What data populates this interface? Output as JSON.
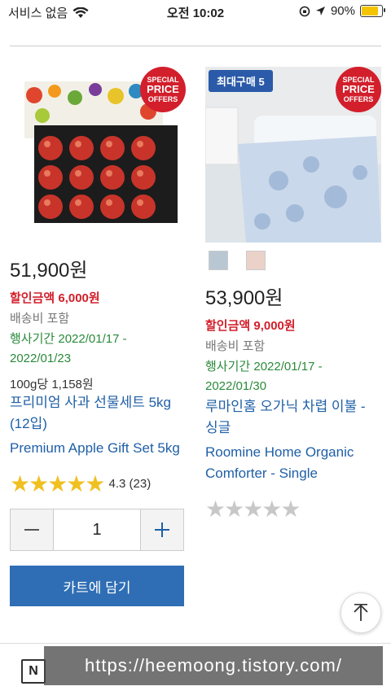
{
  "status_bar": {
    "carrier": "서비스 없음",
    "time": "오전 10:02",
    "battery_text": "90%",
    "battery_level": 0.9,
    "battery_color": "#f5c400"
  },
  "products": [
    {
      "price": "51,900원",
      "discount": "할인금액 6,000원",
      "shipping": "배송비 포함",
      "period": "행사기간 2022/01/17 - 2022/01/23",
      "unit_price": "100g당 1,158원",
      "name_ko": "프리미엄 사과 선물세트 5kg (12입)",
      "name_en": "Premium Apple Gift Set 5kg",
      "badge_special": [
        "SPECIAL",
        "PRICE",
        "OFFERS"
      ],
      "rating_stars": 5,
      "rating_text": "4.3 (23)",
      "quantity": "1",
      "cart_label": "카트에 담기"
    },
    {
      "price": "53,900원",
      "discount": "할인금액 9,000원",
      "shipping": "배송비 포함",
      "period": "행사기간 2022/01/17 - 2022/01/30",
      "name_ko": "루마인홈 오가닉 차렵 이불 - 싱글",
      "name_en": "Roomine Home Organic Comforter - Single",
      "badge_max": "최대구매 5",
      "badge_special": [
        "SPECIAL",
        "PRICE",
        "OFFERS"
      ],
      "swatch_colors": [
        "#b9c7d3",
        "#ead2c8"
      ],
      "rating_stars": 0
    }
  ],
  "bottom_nav": {
    "n_label": "N",
    "watermark": "https://heemoong.tistory.com/"
  },
  "colors": {
    "discount": "#d21f2b",
    "period": "#2a8a3a",
    "link": "#1f5fa6",
    "cart_button": "#2f6eb4",
    "star": "#f0c020"
  }
}
